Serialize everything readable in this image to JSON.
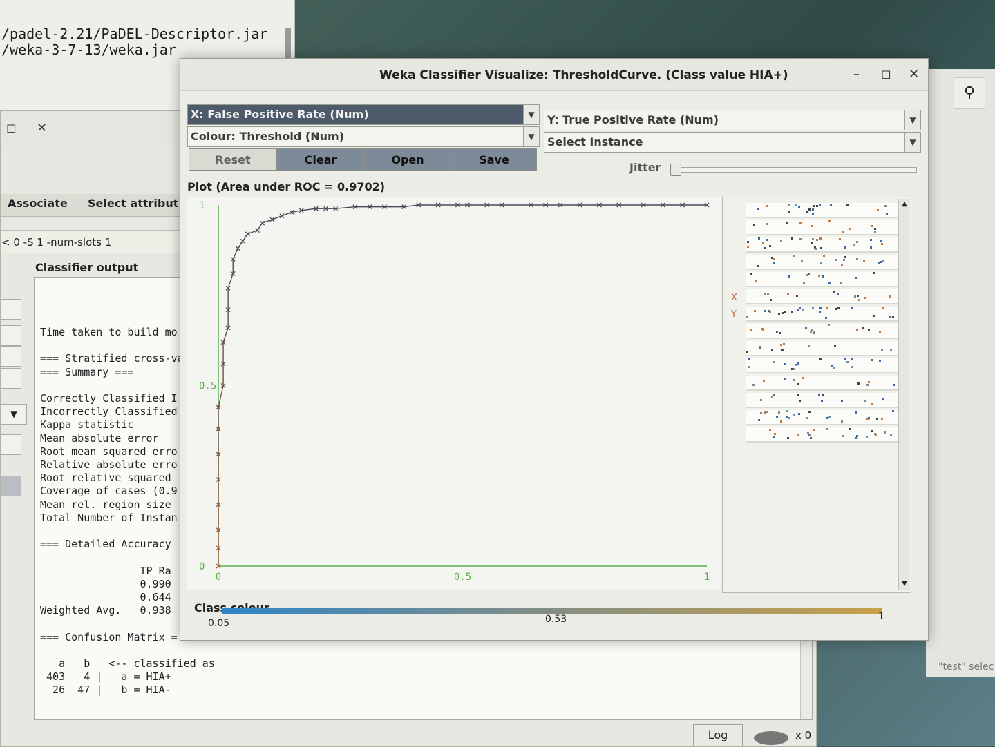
{
  "terminal": {
    "lines": [
      "/padel-2.21/PaDEL-Descriptor.jar",
      "/weka-3-7-13/weka.jar"
    ]
  },
  "explorer": {
    "tabs": [
      "Associate",
      "Select attribut"
    ],
    "options_text": "< 0 -S 1 -num-slots 1",
    "classifier_output_label": "Classifier output",
    "output_lines": [
      "Time taken to build mo",
      "",
      "=== Stratified cross-va",
      "=== Summary ===",
      "",
      "Correctly Classified I",
      "Incorrectly Classified",
      "Kappa statistic",
      "Mean absolute error",
      "Root mean squared erro",
      "Relative absolute erro",
      "Root relative squared",
      "Coverage of cases (0.9",
      "Mean rel. region size",
      "Total Number of Instan",
      "",
      "=== Detailed Accuracy",
      "",
      "                TP Ra",
      "                0.990",
      "                0.644",
      "Weighted Avg.   0.938",
      "",
      "=== Confusion Matrix =",
      "",
      "   a   b   <-- classified as",
      " 403   4 |   a = HIA+",
      "  26  47 |   b = HIA-"
    ],
    "log_button": "Log",
    "status_count": "x 0"
  },
  "right_window": {
    "hint_text": "\"test\" selec"
  },
  "dialog": {
    "title": "Weka Classifier Visualize: ThresholdCurve. (Class value HIA+)",
    "x_combo": "X: False Positive Rate (Num)",
    "y_combo": "Y: True Positive Rate (Num)",
    "colour_combo": "Colour: Threshold (Num)",
    "instance_combo": "Select Instance",
    "buttons": {
      "reset": "Reset",
      "clear": "Clear",
      "open": "Open",
      "save": "Save"
    },
    "jitter_label": "Jitter",
    "jitter_level": 0,
    "plot_title": "Plot (Area under ROC = 0.9702)",
    "side_labels": {
      "x": "X",
      "y": "Y"
    },
    "class_colour_label": "Class colour",
    "class_colour_ticks": [
      "0.05",
      "0.53",
      "1"
    ]
  },
  "chart_data": {
    "type": "scatter",
    "title": "Plot (Area under ROC = 0.9702)",
    "xlabel": "False Positive Rate",
    "ylabel": "True Positive Rate",
    "xlim": [
      0,
      1
    ],
    "ylim": [
      0,
      1
    ],
    "x_ticks": [
      "0",
      "0.5",
      "1"
    ],
    "y_ticks": [
      "0",
      "0.5",
      "1"
    ],
    "series": [
      {
        "points": [
          [
            0.0,
            0.0
          ],
          [
            0.0,
            0.05
          ],
          [
            0.0,
            0.1
          ],
          [
            0.0,
            0.17
          ],
          [
            0.0,
            0.24
          ],
          [
            0.0,
            0.31
          ],
          [
            0.0,
            0.38
          ],
          [
            0.0,
            0.44
          ],
          [
            0.01,
            0.5
          ],
          [
            0.01,
            0.56
          ],
          [
            0.01,
            0.62
          ],
          [
            0.02,
            0.66
          ],
          [
            0.02,
            0.71
          ],
          [
            0.02,
            0.77
          ],
          [
            0.03,
            0.81
          ],
          [
            0.03,
            0.85
          ],
          [
            0.04,
            0.88
          ],
          [
            0.05,
            0.9
          ],
          [
            0.06,
            0.92
          ],
          [
            0.08,
            0.93
          ],
          [
            0.09,
            0.95
          ],
          [
            0.11,
            0.96
          ],
          [
            0.13,
            0.97
          ],
          [
            0.15,
            0.98
          ],
          [
            0.17,
            0.985
          ],
          [
            0.2,
            0.99
          ],
          [
            0.22,
            0.99
          ],
          [
            0.24,
            0.99
          ],
          [
            0.28,
            0.995
          ],
          [
            0.31,
            0.995
          ],
          [
            0.34,
            0.995
          ],
          [
            0.38,
            0.995
          ],
          [
            0.41,
            1.0
          ],
          [
            0.45,
            1.0
          ],
          [
            0.49,
            1.0
          ],
          [
            0.51,
            1.0
          ],
          [
            0.55,
            1.0
          ],
          [
            0.58,
            1.0
          ],
          [
            0.64,
            1.0
          ],
          [
            0.67,
            1.0
          ],
          [
            0.7,
            1.0
          ],
          [
            0.74,
            1.0
          ],
          [
            0.78,
            1.0
          ],
          [
            0.82,
            1.0
          ],
          [
            0.87,
            1.0
          ],
          [
            0.91,
            1.0
          ],
          [
            0.95,
            1.0
          ],
          [
            1.0,
            1.0
          ]
        ]
      }
    ],
    "colour_range": [
      0.05,
      1
    ]
  },
  "colors": {
    "axis": "#5ab04a",
    "curve_low": "#9a5a3a",
    "curve_high": "#4a4a5a",
    "selected_combo": "#4c5a6a"
  }
}
